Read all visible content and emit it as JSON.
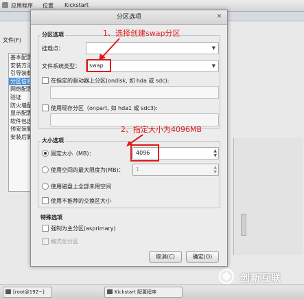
{
  "top_panel": {
    "menus": [
      "应用程序",
      "位置",
      "Kickstart"
    ]
  },
  "background_window": {
    "menu_file": "文件(F)",
    "sidebar_items": [
      "基本配置",
      "安装方法",
      "引导装载",
      "分区信息",
      "网络配置",
      "验证",
      "防火墙配",
      "显示配置",
      "软件包选",
      "预安装脚",
      "安装后脚"
    ]
  },
  "dialog": {
    "title": "分区选项",
    "close_glyph": "×",
    "partition_section": {
      "label": "分区选项",
      "mount_point_label": "挂载点：",
      "mount_point_value": "",
      "fs_type_label": "文件系统类型：",
      "fs_type_value": "swap",
      "on_drive_label": "在指定的驱动器上分区(ondisk, 如 hda 或 sdc):",
      "on_part_label": "使用现存分区（onpart, 如 hda1 或 sdc3):"
    },
    "size_section": {
      "label": "大小选项",
      "fixed_size_label": "固定大小（MB)：",
      "fixed_size_value": "4096",
      "max_size_label": "使用空间的最大限度为(MB)：",
      "max_size_value": "1",
      "fill_disk_label": "使用磁盘上全部未用空间",
      "recommended_swap_label": "使用不推荐的交换区大小"
    },
    "other_section": {
      "label": "特殊选项",
      "force_primary_label": "强制为主分区(asprimary)",
      "format_label": "格式化分区"
    },
    "buttons": {
      "cancel": "取消(C)",
      "ok": "确定(O)"
    }
  },
  "annotations": {
    "step1": "1、选择创建swap分区",
    "step2": "2、指定大小为4096MB"
  },
  "taskbar": {
    "items": [
      "[root@192~]",
      "Kickstart 配置程序"
    ]
  },
  "watermark": {
    "text": "创新互联"
  },
  "colors": {
    "annotation": "#e01818",
    "selection": "#4a90d9"
  }
}
